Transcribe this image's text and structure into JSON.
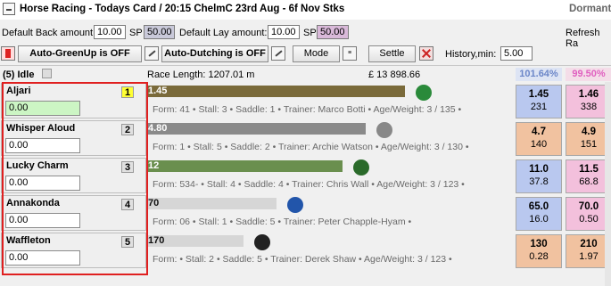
{
  "titlebar": {
    "title": "Horse Racing - Todays Card / 20:15 ChelmC  23rd Aug - 6f Nov Stks",
    "right": "Dormant"
  },
  "toolbar1": {
    "default_back_label": "Default Back amount:",
    "default_back_value": "10.00",
    "sp1_label": "SP",
    "sp1_value": "50.00",
    "default_lay_label": "Default Lay amount:",
    "default_lay_value": "10.00",
    "sp2_label": "SP",
    "sp2_value": "50.00",
    "refresh_label": "Refresh Ra"
  },
  "toolbar2": {
    "auto_greenup": "Auto-GreenUp is OFF",
    "auto_dutching": "Auto-Dutching is OFF",
    "mode": "Mode",
    "settle": "Settle",
    "history_label": "History,min:",
    "history_value": "5.00"
  },
  "status": {
    "idle": "(5) Idle",
    "race_length": "Race Length:  1207.01 m",
    "matched": "£ 13 898.66",
    "back_pct": "101.64%",
    "lay_pct": "99.50%"
  },
  "colors": {
    "back_book": "#6b86c8",
    "lay_book": "#e060c0",
    "back_cell": "#b9c8ef",
    "lay_cell": "#f3c0dc",
    "back_cell_alt": "#f1c2a0",
    "lay_cell_alt": "#f1c2a0"
  },
  "runners": [
    {
      "name": "Aljari",
      "num": "1",
      "amount": "0.00",
      "bar_value": "1.45",
      "bar_fill": 0.78,
      "bar_color": "#7a6a3a",
      "form": "Form: 41  •  Stall: 3  •  Saddle: 1  •  Trainer: Marco Botti  •  Age/Weight: 3 / 135  •",
      "back_odds": "1.45",
      "back_amt": "231",
      "lay_odds": "1.46",
      "lay_amt": "338",
      "style": "blue",
      "num_hl": true
    },
    {
      "name": "Whisper Aloud",
      "num": "2",
      "amount": "0.00",
      "bar_value": "4.80",
      "bar_fill": 0.66,
      "bar_color": "#8a8a8a",
      "form": "Form: 1  •  Stall: 5  •  Saddle: 2  •  Trainer: Archie Watson  •  Age/Weight: 3 / 130  •",
      "back_odds": "4.7",
      "back_amt": "140",
      "lay_odds": "4.9",
      "lay_amt": "151",
      "style": "orange",
      "num_hl": false
    },
    {
      "name": "Lucky Charm",
      "num": "3",
      "amount": "0.00",
      "bar_value": "12",
      "bar_fill": 0.59,
      "bar_color": "#6a8f4e",
      "form": "Form: 534-  •  Stall: 4  •  Saddle: 4  •  Trainer: Chris Wall  •  Age/Weight: 3 / 123  •",
      "back_odds": "11.0",
      "back_amt": "37.8",
      "lay_odds": "11.5",
      "lay_amt": "68.8",
      "style": "blue",
      "num_hl": false
    },
    {
      "name": "Annakonda",
      "num": "4",
      "amount": "0.00",
      "bar_value": "70",
      "bar_fill": 0.39,
      "bar_color": "#d6d6d6",
      "form": "Form: 06  •  Stall: 1  •  Saddle: 5  •  Trainer: Peter Chapple-Hyam  •",
      "back_odds": "65.0",
      "back_amt": "16.0",
      "lay_odds": "70.0",
      "lay_amt": "0.50",
      "style": "blue",
      "num_hl": false
    },
    {
      "name": "Waffleton",
      "num": "5",
      "amount": "0.00",
      "bar_value": "170",
      "bar_fill": 0.29,
      "bar_color": "#d6d6d6",
      "form": "Form:   •  Stall: 2  •  Saddle: 5  •  Trainer: Derek Shaw  •  Age/Weight: 3 / 123  •",
      "back_odds": "130",
      "back_amt": "0.28",
      "lay_odds": "210",
      "lay_amt": "1.97",
      "style": "orange",
      "num_hl": false
    }
  ]
}
